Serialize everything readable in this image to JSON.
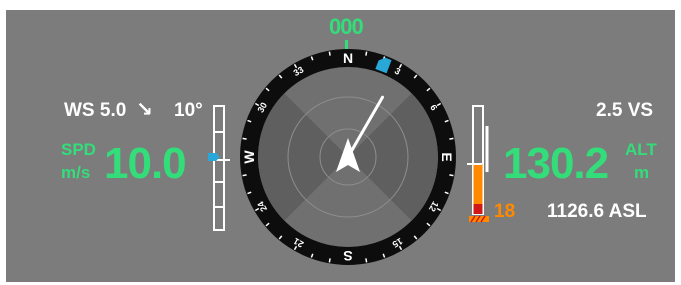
{
  "heading": {
    "value": "000",
    "degrees": 0
  },
  "wind": {
    "speed": "WS 5.0",
    "arrow": "↘",
    "direction": "10°",
    "arrow_icon": "arrow-down-right-icon"
  },
  "speed": {
    "label": "SPD",
    "units": "m/s",
    "value": "10.0"
  },
  "altitude": {
    "value": "130.2",
    "label": "ALT",
    "units": "m"
  },
  "vertical_speed": "2.5 VS",
  "agl_warning": "18",
  "asl": "1126.6 ASL",
  "compass": {
    "cardinals": {
      "n": "N",
      "e": "E",
      "s": "S",
      "w": "W"
    },
    "ticks": [
      "3",
      "6",
      "12",
      "15",
      "21",
      "24",
      "30",
      "33"
    ],
    "pointer_heading_deg": 30,
    "home_bearing_deg": 21
  },
  "colors": {
    "panel": "#7c7c7c",
    "accent_green": "#33dd7a",
    "warning_orange": "#ff8a00",
    "warning_red": "#d01818",
    "home_marker": "#29a8d8"
  }
}
